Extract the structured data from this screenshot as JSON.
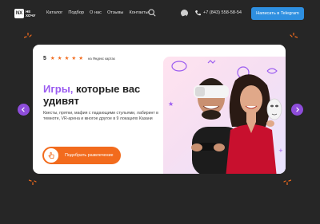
{
  "header": {
    "logo_text": "НЕ ХОЧУ",
    "logo_mark": "NX",
    "nav": [
      "Каталог",
      "Подбор",
      "О нас",
      "Отзывы",
      "Контакты"
    ],
    "phone": "+7 (843) 558-58-54",
    "telegram_button": "Написать в Telegram"
  },
  "hero": {
    "rating_value": "5",
    "rating_stars": 5,
    "rating_label": "на Яндекс картах",
    "title_accent": "Игры,",
    "title_rest": " которые вас удивят",
    "description": "Квесты, прятки, мафия с падающими стульями, лабиринт в темноте, VR-арена и многое другое в 9 локациях Казани",
    "cta_label": "Подобрать развлечение"
  },
  "colors": {
    "background": "#262626",
    "accent_purple": "#9b5cf0",
    "accent_orange": "#f26b1d",
    "telegram_blue": "#2e8fe0"
  },
  "icons": [
    "search-icon",
    "telegram-icon",
    "phone-icon",
    "pointer-hand-icon",
    "arrow-left-icon",
    "arrow-right-icon"
  ]
}
